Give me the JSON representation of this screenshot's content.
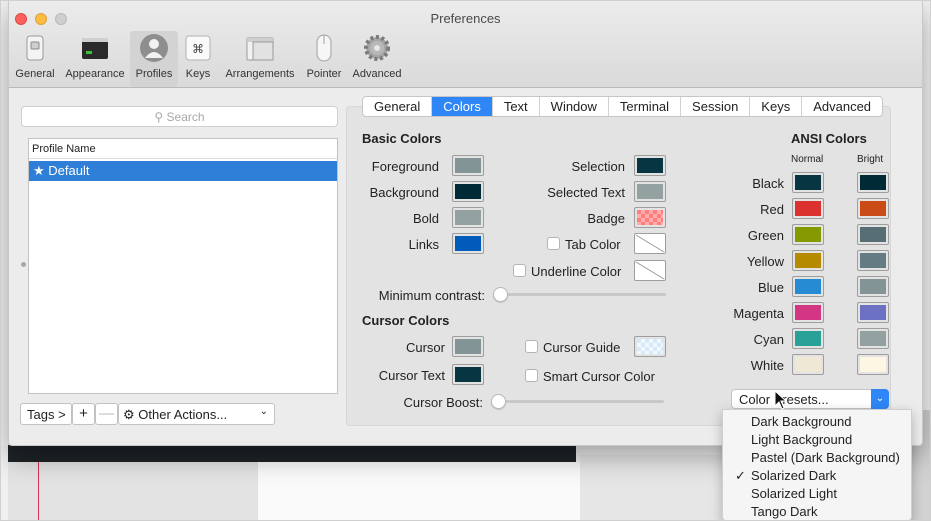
{
  "window": {
    "title": "Preferences",
    "toolbar": [
      {
        "label": "General",
        "icon": "switch-icon"
      },
      {
        "label": "Appearance",
        "icon": "window-icon"
      },
      {
        "label": "Profiles",
        "icon": "person-icon"
      },
      {
        "label": "Keys",
        "icon": "command-key-icon"
      },
      {
        "label": "Arrangements",
        "icon": "windows-icon"
      },
      {
        "label": "Pointer",
        "icon": "mouse-icon"
      },
      {
        "label": "Advanced",
        "icon": "gear-icon"
      }
    ],
    "selected_toolbar": "Profiles"
  },
  "profiles": {
    "search_placeholder": "Search",
    "list_header": "Profile Name",
    "default_row": "★ Default",
    "tags_label": "Tags >",
    "plus": "+",
    "minus": "—",
    "other_actions": "Other Actions..."
  },
  "tabs": [
    "General",
    "Colors",
    "Text",
    "Window",
    "Terminal",
    "Session",
    "Keys",
    "Advanced"
  ],
  "active_tab": "Colors",
  "basic_colors": {
    "title": "Basic Colors",
    "foreground": "Foreground",
    "background": "Background",
    "bold": "Bold",
    "links": "Links",
    "selection": "Selection",
    "selected_text": "Selected Text",
    "badge": "Badge",
    "tab_color": "Tab Color",
    "underline_color": "Underline Color",
    "min_contrast": "Minimum contrast:",
    "colors": {
      "foreground": "#839496",
      "background": "#002b36",
      "bold": "#93a1a1",
      "links": "#005bbb",
      "selection": "#073642",
      "selected_text": "#93a1a1",
      "badge": "#ff7f7f"
    }
  },
  "cursor_colors": {
    "title": "Cursor Colors",
    "cursor": "Cursor",
    "cursor_text": "Cursor Text",
    "cursor_guide": "Cursor Guide",
    "smart_cursor_color": "Smart Cursor Color",
    "cursor_boost": "Cursor Boost:",
    "colors": {
      "cursor": "#839496",
      "cursor_text": "#073642",
      "cursor_guide": "#d5eaf8"
    }
  },
  "ansi": {
    "title": "ANSI Colors",
    "normal": "Normal",
    "bright": "Bright",
    "rows": [
      {
        "name": "Black",
        "normal": "#073642",
        "bright": "#002b36"
      },
      {
        "name": "Red",
        "normal": "#dc322f",
        "bright": "#cb4b16"
      },
      {
        "name": "Green",
        "normal": "#859900",
        "bright": "#586e75"
      },
      {
        "name": "Yellow",
        "normal": "#b58900",
        "bright": "#657b83"
      },
      {
        "name": "Blue",
        "normal": "#268bd2",
        "bright": "#839496"
      },
      {
        "name": "Magenta",
        "normal": "#d33682",
        "bright": "#6c71c4"
      },
      {
        "name": "Cyan",
        "normal": "#2aa198",
        "bright": "#93a1a1"
      },
      {
        "name": "White",
        "normal": "#eee8d5",
        "bright": "#fdf6e3"
      }
    ]
  },
  "presets": {
    "button_label": "Color Presets...",
    "menu": [
      "Dark Background",
      "Light Background",
      "Pastel (Dark Background)",
      "Solarized Dark",
      "Solarized Light",
      "Tango Dark"
    ],
    "checked": "Solarized Dark"
  }
}
